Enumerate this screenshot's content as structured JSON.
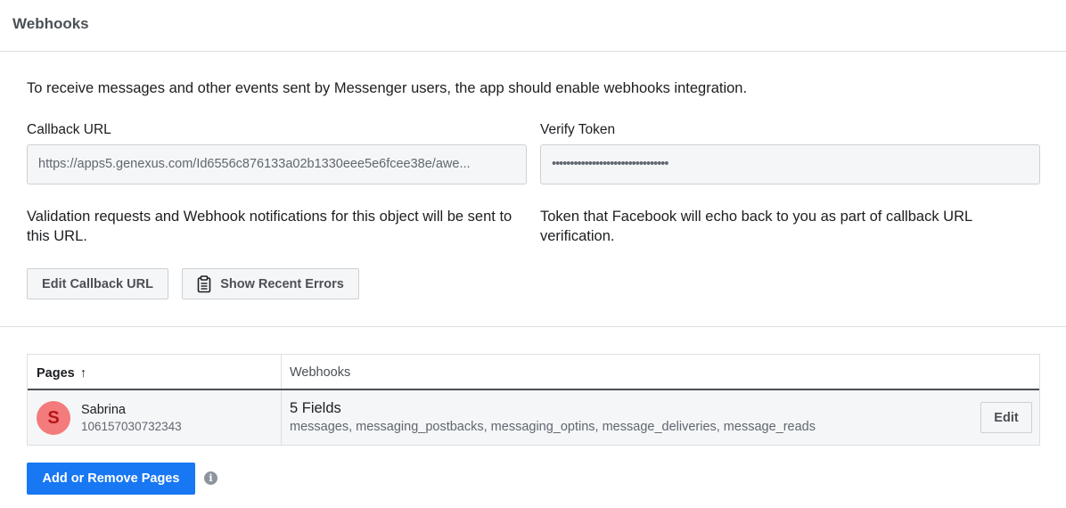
{
  "header": {
    "title": "Webhooks"
  },
  "intro": "To receive messages and other events sent by Messenger users, the app should enable webhooks integration.",
  "callback": {
    "label": "Callback URL",
    "value": "https://apps5.genexus.com/Id6556c876133a02b1330eee5e6fcee38e/awe...",
    "help": "Validation requests and Webhook notifications for this object will be sent to this URL."
  },
  "verify": {
    "label": "Verify Token",
    "value": "••••••••••••••••••••••••••••••••",
    "help": "Token that Facebook will echo back to you as part of callback URL verification."
  },
  "buttons": {
    "edit_callback": "Edit Callback URL",
    "show_errors": "Show Recent Errors",
    "show_errors_icon": "clipboard-icon"
  },
  "table": {
    "headers": {
      "pages": "Pages",
      "sort_arrow": "↑",
      "webhooks": "Webhooks"
    },
    "rows": [
      {
        "avatar_letter": "S",
        "name": "Sabrina",
        "id": "106157030732343",
        "fields_count": "5 Fields",
        "fields": "messages, messaging_postbacks, messaging_optins, message_deliveries, message_reads",
        "edit_label": "Edit"
      }
    ]
  },
  "add_remove": "Add or Remove Pages",
  "info_icon": "info-icon",
  "colors": {
    "primary": "#1877f2",
    "avatar_bg": "#f47b7b",
    "avatar_text": "#b5161b"
  }
}
